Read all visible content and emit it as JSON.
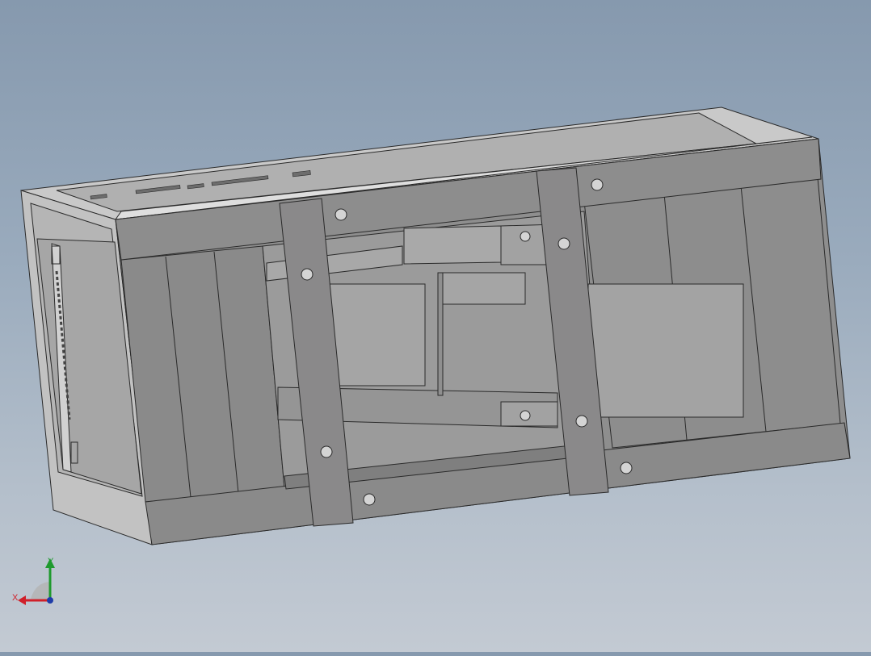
{
  "viewport": {
    "background_top": "#8699ae",
    "background_bottom": "#c3cad3"
  },
  "model": {
    "face_light": "#b9b9b9",
    "face_mid": "#a3a3a3",
    "face_dark": "#8a8a8a",
    "face_darker": "#7d7d7d",
    "strap": "#8c8b8c",
    "edge": "#2a2a2a",
    "hole": "#d6d6d6"
  },
  "triad": {
    "x_label": "X",
    "y_label": "Y",
    "x_color": "#d0202a",
    "y_color": "#1f9a2e",
    "z_color": "#1e3ca8",
    "x_icon": "x-axis-arrow-icon",
    "y_icon": "y-axis-arrow-icon"
  }
}
